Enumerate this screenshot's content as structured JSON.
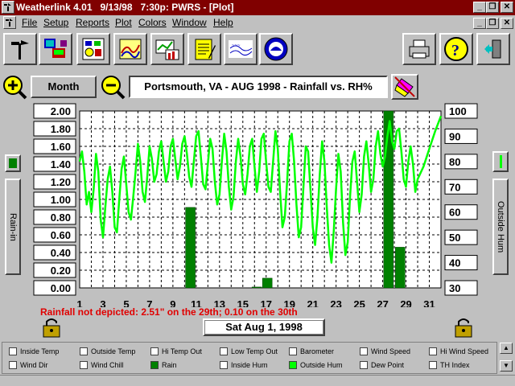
{
  "window": {
    "title": "Weatherlink 4.01   9/13/98   7:30p: PWRS - [Plot]",
    "title_bg": "#800000"
  },
  "menu": [
    "File",
    "Setup",
    "Reports",
    "Plot",
    "Colors",
    "Window",
    "Help"
  ],
  "toolbar": {
    "left_buttons": [
      "weather-station-icon",
      "computer-link-icon",
      "summary-panel-icon",
      "graph-icon",
      "bar-plot-icon",
      "notepad-icon",
      "rain-map-icon",
      "noaa-icon"
    ],
    "right_buttons": [
      "printer-icon",
      "help-icon",
      "exit-icon"
    ]
  },
  "controls": {
    "period_label": "Month",
    "plot_title": "Portsmouth, VA - AUG 1998 - Rainfall vs. RH%"
  },
  "plot": {
    "left_axis_label": "Rain-in",
    "right_axis_label": "Outside Hum",
    "date": "Sat Aug 1, 1998",
    "note": "Rainfall not depicted: 2.51\" on the 29th; 0.10 on the 30th"
  },
  "chart_data": {
    "type": "bar",
    "x_ticks": [
      "1",
      "3",
      "5",
      "7",
      "9",
      "11",
      "13",
      "15",
      "17",
      "19",
      "21",
      "23",
      "25",
      "27",
      "29",
      "31"
    ],
    "xlim": [
      1,
      32
    ],
    "y_left_ticks": [
      "2.00",
      "1.80",
      "1.60",
      "1.40",
      "1.20",
      "1.00",
      "0.80",
      "0.60",
      "0.40",
      "0.20",
      "0.00"
    ],
    "y_left_lim": [
      0,
      2
    ],
    "y_right_ticks": [
      "100",
      "90",
      "80",
      "70",
      "60",
      "50",
      "40",
      "30"
    ],
    "y_right_lim": [
      30,
      100
    ],
    "rain_color": "#008000",
    "humidity_color": "#00ff00",
    "rain": [
      {
        "day": 10.5,
        "value": 0.91
      },
      {
        "day": 16.2,
        "value": 0.01
      },
      {
        "day": 17.1,
        "value": 0.11
      },
      {
        "day": 27.5,
        "value": 2.0
      },
      {
        "day": 28.5,
        "value": 0.46
      }
    ],
    "humidity": [
      [
        1.0,
        80
      ],
      [
        1.2,
        84
      ],
      [
        1.4,
        76
      ],
      [
        1.6,
        63
      ],
      [
        1.8,
        68
      ],
      [
        2.0,
        60
      ],
      [
        2.2,
        69
      ],
      [
        2.4,
        83
      ],
      [
        2.6,
        76
      ],
      [
        2.8,
        57
      ],
      [
        3.0,
        50
      ],
      [
        3.2,
        62
      ],
      [
        3.4,
        73
      ],
      [
        3.6,
        78
      ],
      [
        3.8,
        68
      ],
      [
        4.0,
        54
      ],
      [
        4.2,
        52
      ],
      [
        4.4,
        65
      ],
      [
        4.6,
        77
      ],
      [
        4.8,
        82
      ],
      [
        5.0,
        71
      ],
      [
        5.2,
        60
      ],
      [
        5.4,
        57
      ],
      [
        5.6,
        66
      ],
      [
        5.8,
        76
      ],
      [
        6.0,
        87
      ],
      [
        6.2,
        80
      ],
      [
        6.4,
        68
      ],
      [
        6.6,
        64
      ],
      [
        6.8,
        74
      ],
      [
        7.0,
        86
      ],
      [
        7.2,
        81
      ],
      [
        7.4,
        72
      ],
      [
        7.6,
        75
      ],
      [
        7.8,
        84
      ],
      [
        8.0,
        88
      ],
      [
        8.2,
        80
      ],
      [
        8.4,
        72
      ],
      [
        8.6,
        76
      ],
      [
        8.8,
        86
      ],
      [
        9.0,
        89
      ],
      [
        9.2,
        81
      ],
      [
        9.4,
        73
      ],
      [
        9.6,
        78
      ],
      [
        9.8,
        87
      ],
      [
        10.0,
        90
      ],
      [
        10.2,
        83
      ],
      [
        10.4,
        74
      ],
      [
        10.6,
        70
      ],
      [
        10.8,
        80
      ],
      [
        11.0,
        90
      ],
      [
        11.2,
        92
      ],
      [
        11.4,
        82
      ],
      [
        11.6,
        71
      ],
      [
        11.8,
        69
      ],
      [
        12.0,
        79
      ],
      [
        12.2,
        89
      ],
      [
        12.4,
        85
      ],
      [
        12.6,
        72
      ],
      [
        12.8,
        63
      ],
      [
        13.0,
        67
      ],
      [
        13.2,
        80
      ],
      [
        13.4,
        91
      ],
      [
        13.6,
        84
      ],
      [
        13.8,
        70
      ],
      [
        14.0,
        61
      ],
      [
        14.2,
        66
      ],
      [
        14.4,
        80
      ],
      [
        14.6,
        89
      ],
      [
        14.8,
        82
      ],
      [
        15.0,
        71
      ],
      [
        15.2,
        67
      ],
      [
        15.4,
        75
      ],
      [
        15.6,
        86
      ],
      [
        15.8,
        89
      ],
      [
        16.0,
        78
      ],
      [
        16.2,
        68
      ],
      [
        16.4,
        76
      ],
      [
        16.6,
        89
      ],
      [
        16.8,
        91
      ],
      [
        17.0,
        80
      ],
      [
        17.2,
        70
      ],
      [
        17.4,
        68
      ],
      [
        17.6,
        80
      ],
      [
        17.8,
        92
      ],
      [
        18.0,
        85
      ],
      [
        18.2,
        68
      ],
      [
        18.4,
        54
      ],
      [
        18.6,
        58
      ],
      [
        18.8,
        72
      ],
      [
        19.0,
        88
      ],
      [
        19.2,
        91
      ],
      [
        19.4,
        80
      ],
      [
        19.6,
        63
      ],
      [
        19.8,
        50
      ],
      [
        20.0,
        54
      ],
      [
        20.2,
        70
      ],
      [
        20.4,
        86
      ],
      [
        20.6,
        84
      ],
      [
        20.8,
        69
      ],
      [
        21.0,
        54
      ],
      [
        21.2,
        47
      ],
      [
        21.4,
        58
      ],
      [
        21.6,
        75
      ],
      [
        21.8,
        88
      ],
      [
        22.0,
        80
      ],
      [
        22.2,
        62
      ],
      [
        22.4,
        47
      ],
      [
        22.6,
        40
      ],
      [
        22.8,
        52
      ],
      [
        23.0,
        69
      ],
      [
        23.2,
        83
      ],
      [
        23.4,
        76
      ],
      [
        23.6,
        56
      ],
      [
        23.8,
        43
      ],
      [
        24.0,
        48
      ],
      [
        24.2,
        66
      ],
      [
        24.4,
        80
      ],
      [
        24.6,
        84
      ],
      [
        24.8,
        72
      ],
      [
        25.0,
        60
      ],
      [
        25.2,
        67
      ],
      [
        25.4,
        82
      ],
      [
        25.6,
        88
      ],
      [
        25.8,
        79
      ],
      [
        26.0,
        68
      ],
      [
        26.2,
        73
      ],
      [
        26.4,
        86
      ],
      [
        26.6,
        92
      ],
      [
        26.8,
        83
      ],
      [
        27.0,
        78
      ],
      [
        27.2,
        82
      ],
      [
        27.4,
        90
      ],
      [
        27.6,
        96
      ],
      [
        27.8,
        88
      ],
      [
        28.0,
        85
      ],
      [
        28.2,
        92
      ],
      [
        28.4,
        93
      ],
      [
        28.6,
        84
      ],
      [
        28.8,
        73
      ],
      [
        29.0,
        70
      ],
      [
        29.2,
        80
      ],
      [
        29.4,
        86
      ],
      [
        29.6,
        79
      ],
      [
        29.8,
        68
      ],
      [
        30.0,
        73
      ],
      [
        30.5,
        78
      ],
      [
        31.0,
        85
      ],
      [
        31.5,
        92
      ],
      [
        32.0,
        98
      ]
    ]
  },
  "legend": [
    {
      "label": "Inside Temp",
      "checked": false
    },
    {
      "label": "Outside Temp",
      "checked": false
    },
    {
      "label": "Hi Temp Out",
      "checked": false
    },
    {
      "label": "Low Temp Out",
      "checked": false
    },
    {
      "label": "Barometer",
      "checked": false
    },
    {
      "label": "Wind Speed",
      "checked": false
    },
    {
      "label": "Hi Wind Speed",
      "checked": false
    },
    {
      "label": "Wind Dir",
      "checked": false
    },
    {
      "label": "Wind Chill",
      "checked": false
    },
    {
      "label": "Rain",
      "checked": true,
      "color": "#008000"
    },
    {
      "label": "Inside Hum",
      "checked": false
    },
    {
      "label": "Outside Hum",
      "checked": true,
      "color": "#00ff00"
    },
    {
      "label": "Dew Point",
      "checked": false
    },
    {
      "label": "TH Index",
      "checked": false
    }
  ]
}
